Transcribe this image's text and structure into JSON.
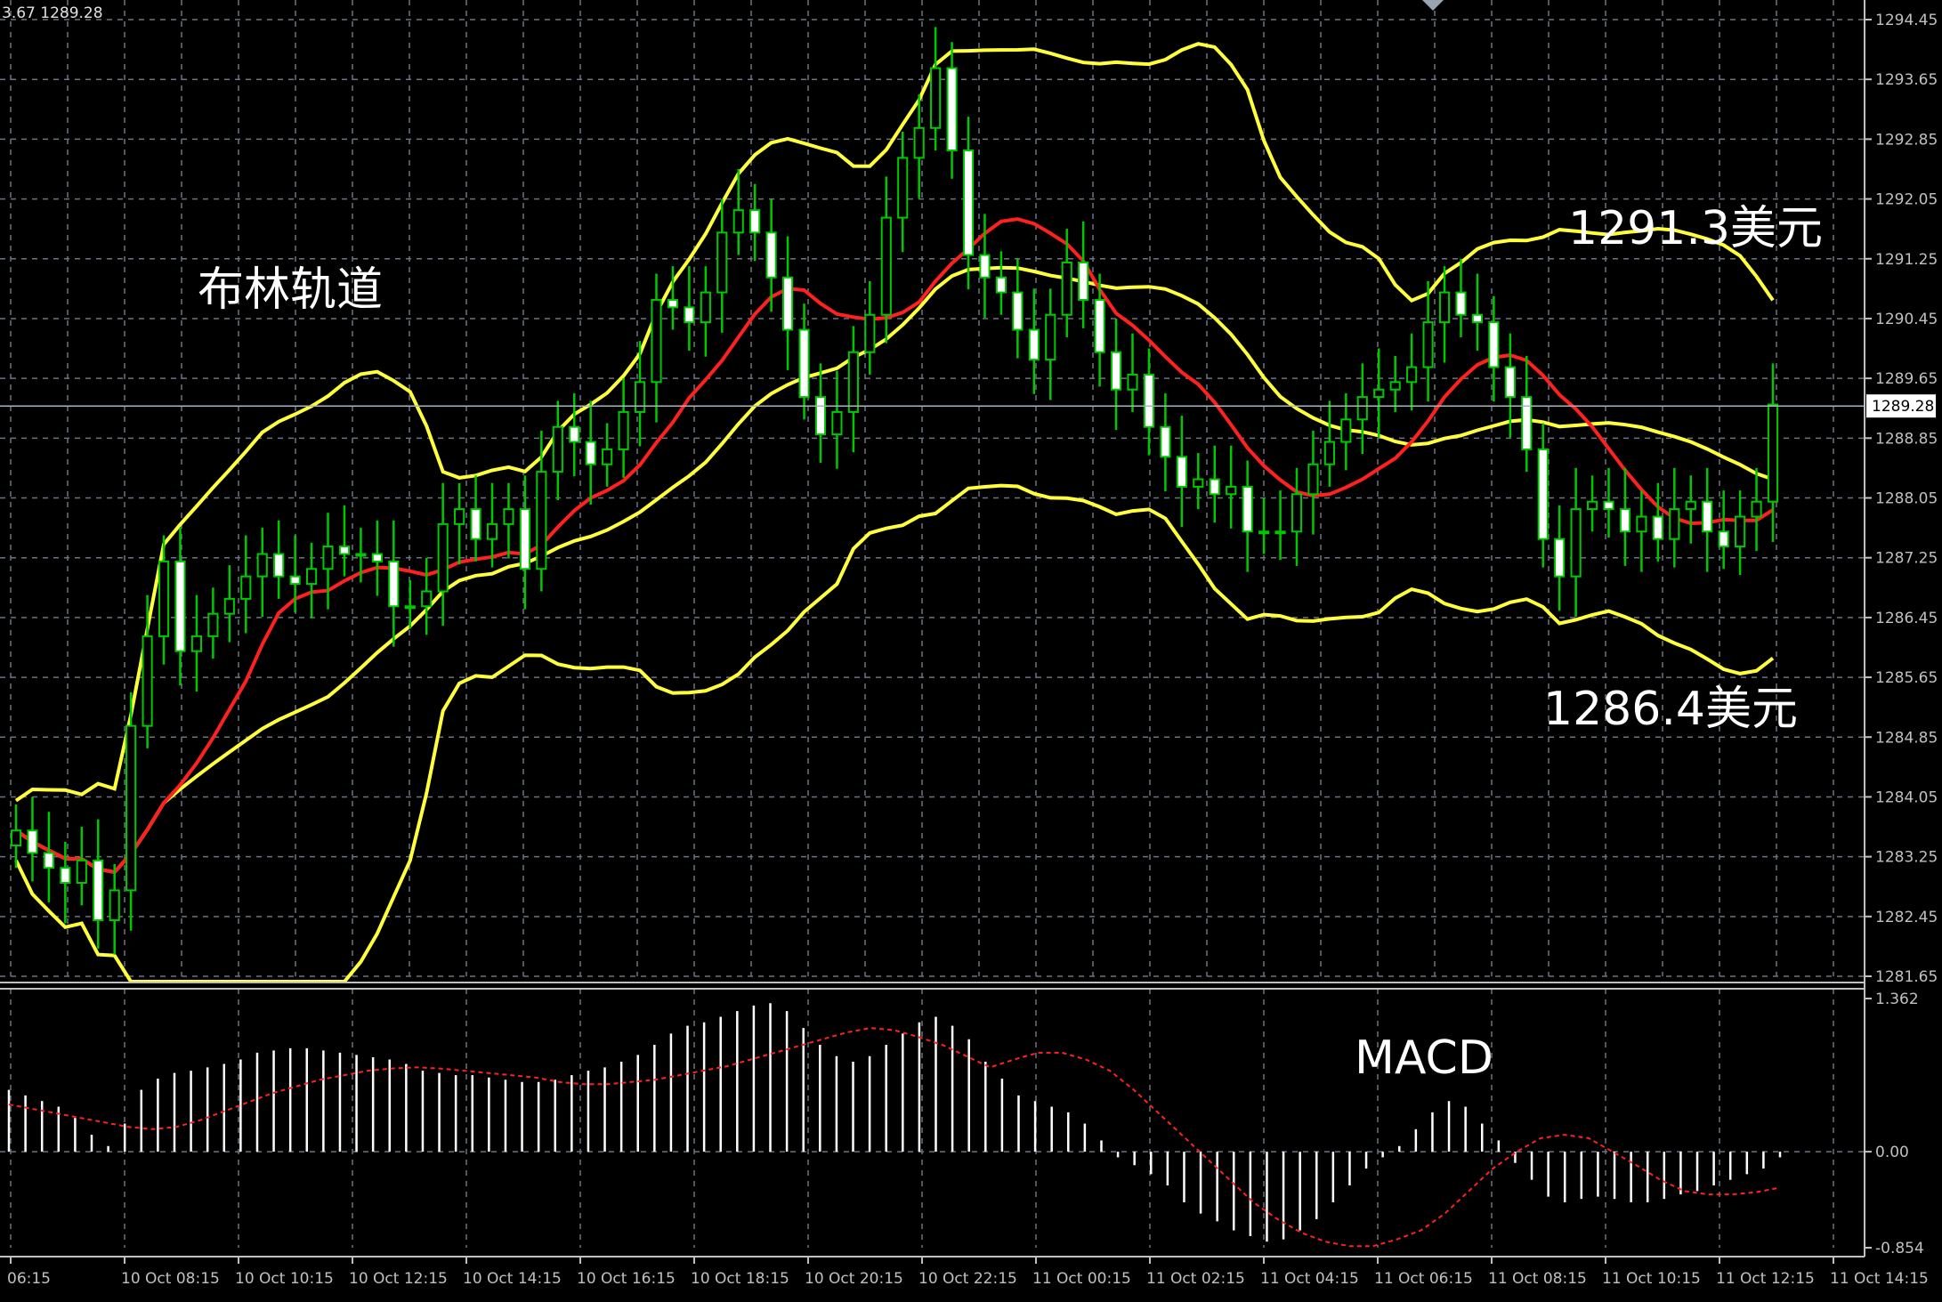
{
  "header": {
    "info": "3.67 1289.28"
  },
  "annotations": {
    "bollinger_label": "布林轨道",
    "upper_band_label": "1291.3美元",
    "lower_band_label": "1286.4美元",
    "macd_label": "MACD"
  },
  "colors": {
    "background": "#000000",
    "grid": "#6b7480",
    "axis": "#c0c0c0",
    "bull_candle": "#00c800",
    "bear_candle_body": "#ffffff",
    "bollinger_band": "#ffff3c",
    "moving_average": "#ff2020",
    "current_price_line": "#aab4c2",
    "macd_histogram": "#ffffff",
    "macd_signal": "#ff2020",
    "annotation_text": "#ffffff"
  },
  "chart_data": [
    {
      "type": "candlestick",
      "overlays": [
        "Bollinger Bands",
        "Moving Average"
      ],
      "grid": true,
      "current_price": 1289.28,
      "y_ticks": [
        "1294.45",
        "1293.65",
        "1292.85",
        "1292.05",
        "1291.25",
        "1290.45",
        "1289.65",
        "1288.85",
        "1288.05",
        "1287.25",
        "1286.45",
        "1285.65",
        "1284.85",
        "1284.05",
        "1283.25",
        "1282.45",
        "1281.65"
      ],
      "ylim": [
        1281.65,
        1294.45
      ],
      "x_ticks": [
        "06:15",
        "10 Oct 08:15",
        "10 Oct 10:15",
        "10 Oct 12:15",
        "10 Oct 14:15",
        "10 Oct 16:15",
        "10 Oct 18:15",
        "10 Oct 20:15",
        "10 Oct 22:15",
        "11 Oct 00:15",
        "11 Oct 02:15",
        "11 Oct 04:15",
        "11 Oct 06:15",
        "11 Oct 08:15",
        "11 Oct 10:15",
        "11 Oct 12:15",
        "11 Oct 14:15"
      ],
      "candles_close": [
        1283.6,
        1283.3,
        1283.1,
        1282.9,
        1283.2,
        1282.4,
        1282.8,
        1285.0,
        1286.2,
        1287.2,
        1286.0,
        1286.2,
        1286.5,
        1286.7,
        1287.0,
        1287.3,
        1287.0,
        1286.9,
        1287.1,
        1287.4,
        1287.3,
        1287.3,
        1287.2,
        1286.6,
        1286.6,
        1286.8,
        1287.7,
        1287.9,
        1287.5,
        1287.7,
        1287.9,
        1287.1,
        1288.4,
        1289.0,
        1288.8,
        1288.5,
        1288.7,
        1289.2,
        1289.6,
        1290.7,
        1290.6,
        1290.4,
        1290.8,
        1291.6,
        1291.9,
        1291.6,
        1291.0,
        1290.3,
        1289.4,
        1288.9,
        1289.2,
        1290.0,
        1290.5,
        1291.8,
        1292.6,
        1293.0,
        1293.8,
        1292.7,
        1291.3,
        1291.0,
        1290.8,
        1290.3,
        1289.9,
        1290.5,
        1291.2,
        1290.7,
        1290.0,
        1289.5,
        1289.7,
        1289.0,
        1288.6,
        1288.2,
        1288.3,
        1288.1,
        1288.2,
        1287.6,
        1287.6,
        1287.6,
        1288.1,
        1288.5,
        1288.8,
        1289.1,
        1289.4,
        1289.5,
        1289.6,
        1289.8,
        1290.4,
        1290.8,
        1290.5,
        1290.4,
        1289.8,
        1289.4,
        1288.7,
        1287.5,
        1287.0,
        1287.9,
        1288.0,
        1287.9,
        1287.6,
        1287.8,
        1287.5,
        1287.9,
        1288.0,
        1287.6,
        1287.4,
        1287.8,
        1288.0,
        1289.3
      ]
    },
    {
      "type": "bar",
      "indicator": "MACD",
      "y_ticks": [
        "1.362",
        "0.00",
        "-0.854"
      ],
      "ylim": [
        -0.854,
        1.362
      ],
      "x_ticks": [
        "06:15",
        "10 Oct 08:15",
        "10 Oct 10:15",
        "10 Oct 12:15",
        "10 Oct 14:15",
        "10 Oct 16:15",
        "10 Oct 18:15",
        "10 Oct 20:15",
        "10 Oct 22:15",
        "11 Oct 00:15",
        "11 Oct 02:15",
        "11 Oct 04:15",
        "11 Oct 06:15",
        "11 Oct 08:15",
        "11 Oct 10:15",
        "11 Oct 12:15",
        "11 Oct 14:15"
      ],
      "histogram": [
        0.55,
        0.5,
        0.45,
        0.4,
        0.3,
        0.15,
        0.05,
        0.25,
        0.55,
        0.65,
        0.7,
        0.72,
        0.75,
        0.78,
        0.82,
        0.88,
        0.9,
        0.92,
        0.92,
        0.9,
        0.88,
        0.86,
        0.84,
        0.82,
        0.78,
        0.72,
        0.7,
        0.68,
        0.68,
        0.66,
        0.64,
        0.62,
        0.62,
        0.64,
        0.68,
        0.72,
        0.75,
        0.8,
        0.86,
        0.95,
        1.05,
        1.12,
        1.15,
        1.2,
        1.25,
        1.3,
        1.32,
        1.25,
        1.1,
        0.95,
        0.85,
        0.8,
        0.85,
        0.95,
        1.05,
        1.15,
        1.2,
        1.12,
        1.0,
        0.8,
        0.65,
        0.5,
        0.45,
        0.4,
        0.35,
        0.25,
        0.1,
        -0.05,
        -0.12,
        -0.2,
        -0.3,
        -0.45,
        -0.55,
        -0.62,
        -0.7,
        -0.75,
        -0.8,
        -0.78,
        -0.7,
        -0.6,
        -0.45,
        -0.3,
        -0.15,
        -0.05,
        0.05,
        0.2,
        0.35,
        0.45,
        0.4,
        0.25,
        0.1,
        -0.1,
        -0.25,
        -0.4,
        -0.45,
        -0.42,
        -0.4,
        -0.42,
        -0.45,
        -0.45,
        -0.42,
        -0.38,
        -0.35,
        -0.3,
        -0.25,
        -0.2,
        -0.15,
        -0.05
      ],
      "signal": [
        0.42,
        0.38,
        0.34,
        0.3,
        0.26,
        0.22,
        0.2,
        0.22,
        0.28,
        0.36,
        0.44,
        0.52,
        0.58,
        0.64,
        0.68,
        0.72,
        0.74,
        0.75,
        0.74,
        0.72,
        0.7,
        0.68,
        0.66,
        0.62,
        0.6,
        0.6,
        0.62,
        0.64,
        0.68,
        0.72,
        0.76,
        0.82,
        0.88,
        0.94,
        1.0,
        1.06,
        1.1,
        1.08,
        1.02,
        0.95,
        0.85,
        0.75,
        0.82,
        0.88,
        0.88,
        0.82,
        0.72,
        0.55,
        0.35,
        0.15,
        -0.05,
        -0.25,
        -0.45,
        -0.6,
        -0.72,
        -0.8,
        -0.84,
        -0.84,
        -0.78,
        -0.7,
        -0.55,
        -0.35,
        -0.15,
        0.0,
        0.12,
        0.15,
        0.12,
        0.0,
        -0.12,
        -0.25,
        -0.35,
        -0.38,
        -0.38,
        -0.36,
        -0.32
      ]
    }
  ]
}
